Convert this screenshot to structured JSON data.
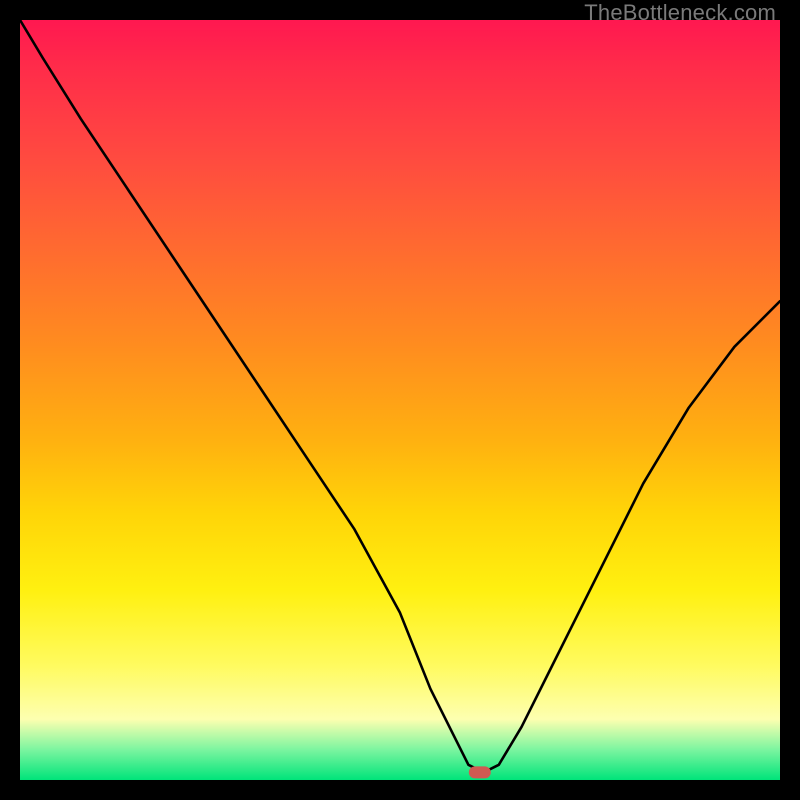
{
  "watermark": "TheBottleneck.com",
  "chart_data": {
    "type": "line",
    "title": "",
    "xlabel": "",
    "ylabel": "",
    "xlim": [
      0,
      100
    ],
    "ylim": [
      0,
      100
    ],
    "grid": false,
    "legend": false,
    "series": [
      {
        "name": "curve",
        "x": [
          0,
          3,
          8,
          14,
          20,
          26,
          32,
          38,
          44,
          50,
          54,
          57,
          59,
          61,
          63,
          66,
          70,
          76,
          82,
          88,
          94,
          100
        ],
        "y": [
          100,
          95,
          87,
          78,
          69,
          60,
          51,
          42,
          33,
          22,
          12,
          6,
          2,
          1,
          2,
          7,
          15,
          27,
          39,
          49,
          57,
          63
        ]
      }
    ],
    "marker": {
      "x": 60.5,
      "y": 1
    },
    "background_gradient_stops": [
      {
        "pos": 0.0,
        "color": "#ff1850"
      },
      {
        "pos": 0.06,
        "color": "#ff2b4a"
      },
      {
        "pos": 0.18,
        "color": "#ff4a40"
      },
      {
        "pos": 0.3,
        "color": "#ff6a30"
      },
      {
        "pos": 0.42,
        "color": "#ff8a20"
      },
      {
        "pos": 0.55,
        "color": "#ffb010"
      },
      {
        "pos": 0.65,
        "color": "#ffd508"
      },
      {
        "pos": 0.75,
        "color": "#fff010"
      },
      {
        "pos": 0.85,
        "color": "#fffb60"
      },
      {
        "pos": 0.92,
        "color": "#fdffb0"
      },
      {
        "pos": 0.96,
        "color": "#7cf5a0"
      },
      {
        "pos": 1.0,
        "color": "#00e47a"
      }
    ]
  }
}
